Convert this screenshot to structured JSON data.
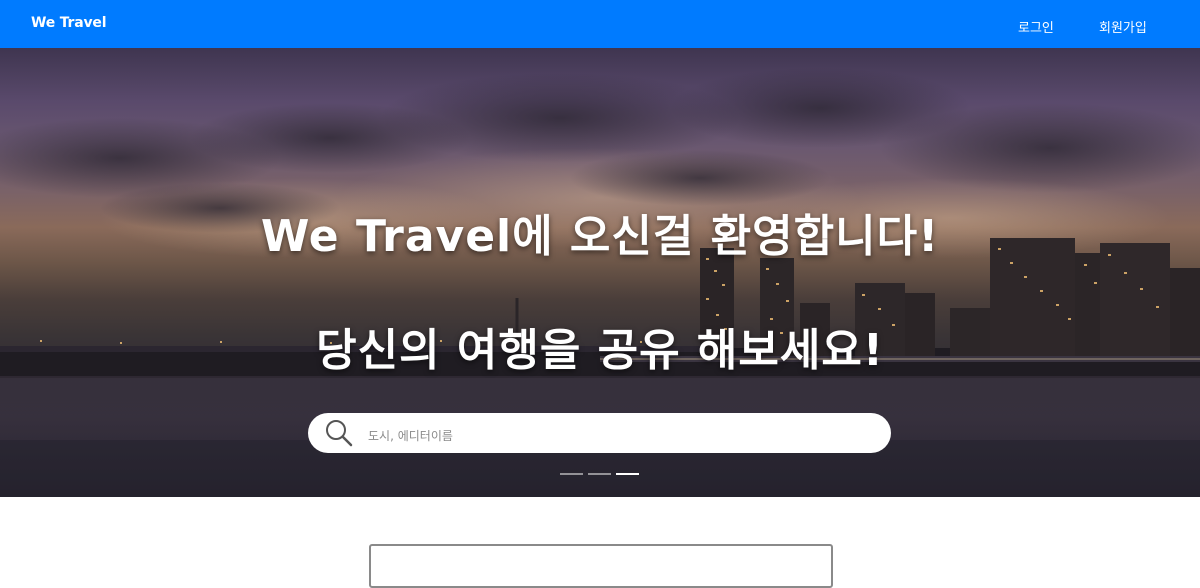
{
  "navbar": {
    "brand": "We Travel",
    "login_label": "로그인",
    "signup_label": "회원가입",
    "color": "#007bff"
  },
  "hero": {
    "title_line1": "We Travel에 오신걸 환영합니다!",
    "title_line2": "당신의 여행을 공유 해보세요!",
    "search": {
      "placeholder": "도시, 에디터이름"
    },
    "carousel": {
      "slide_count": 3,
      "active_index": 2
    }
  },
  "icons": {
    "search": "search-icon"
  }
}
